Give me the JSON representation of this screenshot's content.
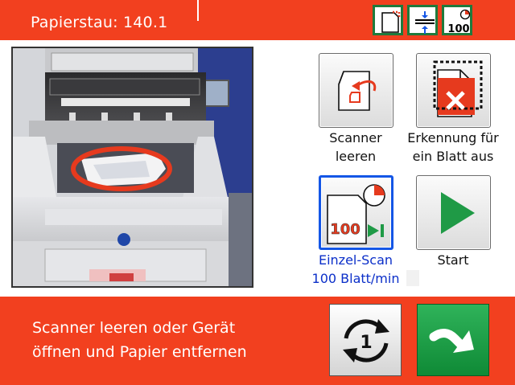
{
  "header": {
    "title": "Papierstau: 140.1",
    "status_icons": [
      {
        "name": "page-corner-icon"
      },
      {
        "name": "compress-height-icon"
      },
      {
        "name": "speed-100-icon",
        "text": "100"
      }
    ]
  },
  "actions": [
    {
      "id": "scanner-leeren",
      "line1": "Scanner",
      "line2": "leeren",
      "icon": "empty-scanner-icon"
    },
    {
      "id": "single-sheet-detection",
      "line1": "Erkennung für",
      "line2": "ein Blatt aus",
      "icon": "single-sheet-off-icon"
    },
    {
      "id": "einzel-scan",
      "line1": "Einzel-Scan",
      "line2": "100 Blatt/min",
      "icon": "single-scan-icon",
      "icon_text": "100",
      "active": true
    },
    {
      "id": "start",
      "line1": "Start",
      "line2": "",
      "icon": "play-icon"
    }
  ],
  "footer": {
    "message_line1": "Scanner leeren oder Gerät",
    "message_line2": "öffnen und Papier entfernen",
    "counter_value": "1",
    "reset_icon": "refresh-counter-icon",
    "confirm_icon": "curved-arrow-icon"
  },
  "colors": {
    "brand_red": "#f2401f",
    "accent_green": "#1f9a46",
    "active_blue": "#1456e6",
    "alert_red": "#e63a1e"
  }
}
